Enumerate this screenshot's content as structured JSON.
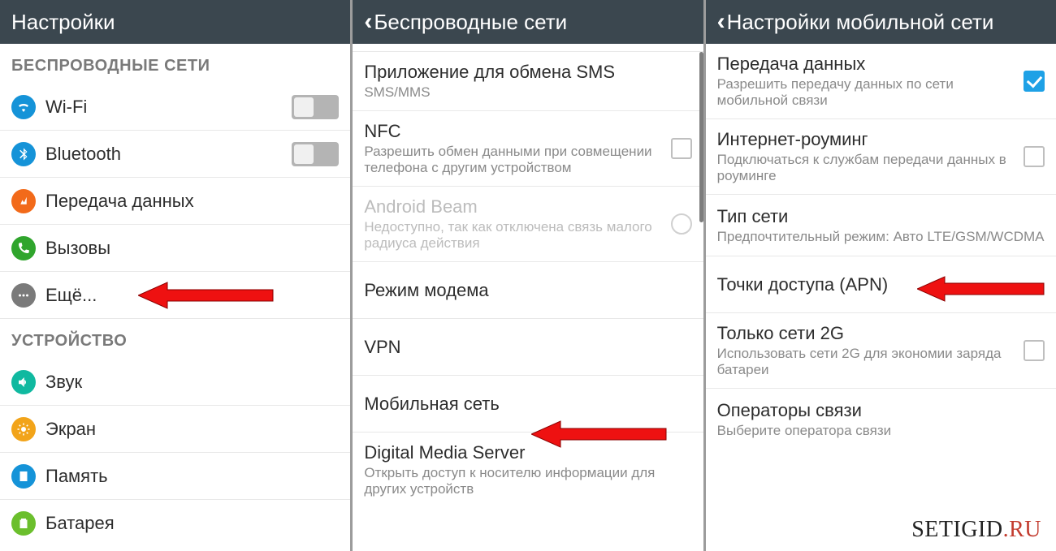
{
  "panel1": {
    "title": "Настройки",
    "section_wireless": "БЕСПРОВОДНЫЕ СЕТИ",
    "section_device": "УСТРОЙСТВО",
    "items": {
      "wifi": "Wi-Fi",
      "bluetooth": "Bluetooth",
      "data": "Передача данных",
      "calls": "Вызовы",
      "more": "Ещё...",
      "sound": "Звук",
      "screen": "Экран",
      "memory": "Память",
      "battery": "Батарея"
    }
  },
  "panel2": {
    "title": "Беспроводные сети",
    "items": {
      "sms_title": "Приложение для обмена SMS",
      "sms_sub": "SMS/MMS",
      "nfc_title": "NFC",
      "nfc_sub": "Разрешить обмен данными при совмещении телефона с другим устройством",
      "beam_title": "Android Beam",
      "beam_sub": "Недоступно, так как отключена связь малого радиуса действия",
      "tether": "Режим модема",
      "vpn": "VPN",
      "mobile": "Мобильная сеть",
      "dms_title": "Digital Media Server",
      "dms_sub": "Открыть доступ к носителю информации для других устройств"
    }
  },
  "panel3": {
    "title": "Настройки мобильной сети",
    "items": {
      "data_title": "Передача данных",
      "data_sub": "Разрешить передачу данных по сети мобильной связи",
      "roam_title": "Интернет-роуминг",
      "roam_sub": "Подключаться к службам передачи данных в роуминге",
      "type_title": "Тип сети",
      "type_sub": "Предпочтительный режим: Авто LTE/GSM/WCDMA",
      "apn": "Точки доступа (APN)",
      "only2g_title": "Только сети 2G",
      "only2g_sub": "Использовать сети 2G для экономии заряда батареи",
      "oper_title": "Операторы связи",
      "oper_sub": "Выберите оператора связи"
    }
  },
  "watermark": {
    "a": "SETIGID",
    "b": ".RU"
  }
}
